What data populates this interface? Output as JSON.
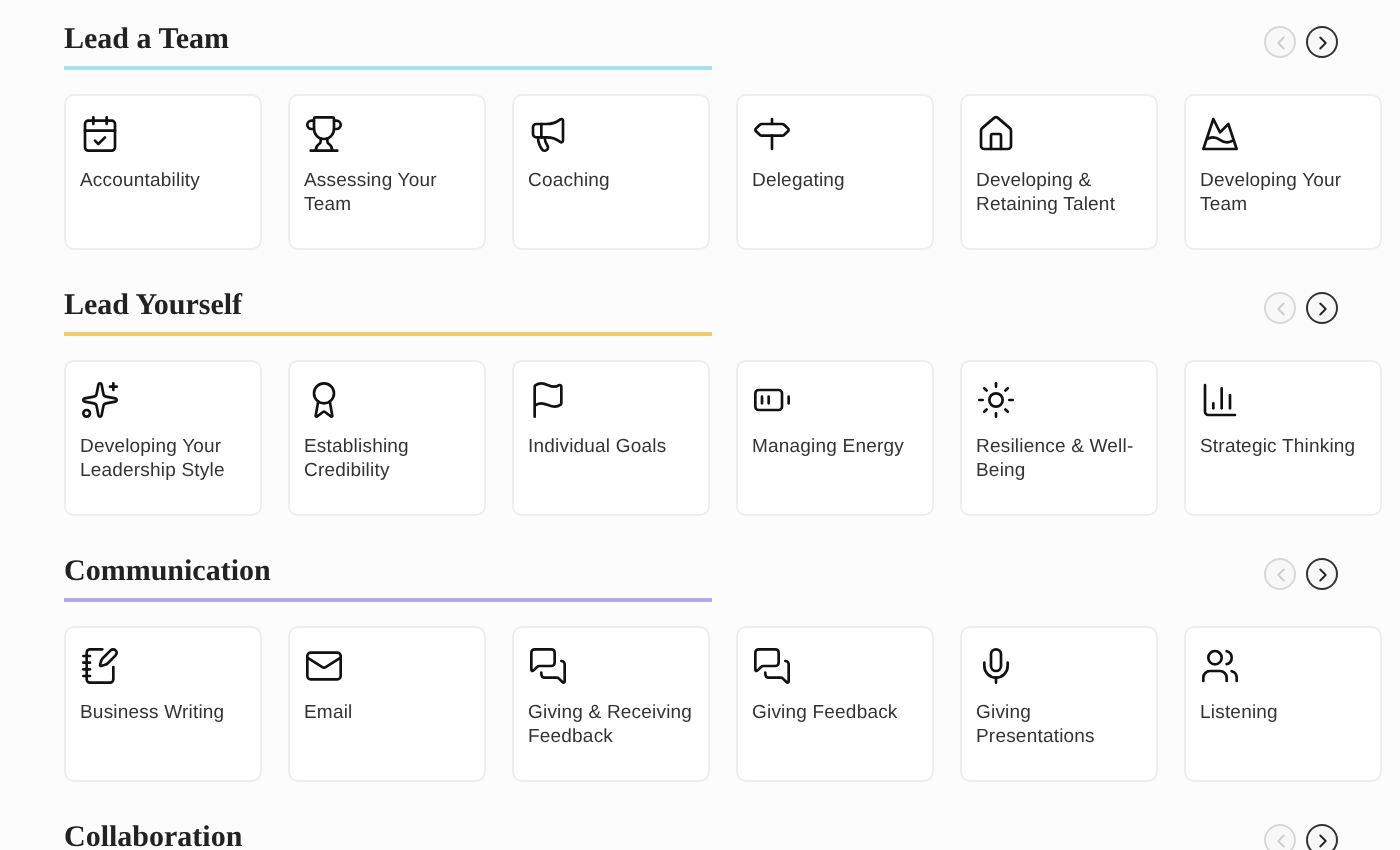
{
  "sections": [
    {
      "title": "Lead a Team",
      "color": "#a6e3ef",
      "nav": [
        {
          "kind": "prev",
          "disabled": true
        },
        {
          "kind": "next",
          "disabled": false
        }
      ],
      "cards": [
        "Accountability",
        "Assessing Your Team",
        "Coaching",
        "Delegating",
        "Developing & Retaining Talent",
        "Developing Your Team"
      ]
    },
    {
      "title": "Lead Yourself",
      "color": "#f3cc6a",
      "nav": [
        {
          "kind": "prev",
          "disabled": true
        },
        {
          "kind": "next",
          "disabled": false
        }
      ],
      "cards": [
        "Developing Your Leadership Style",
        "Establishing Credibility",
        "Individual Goals",
        "Managing Energy",
        "Resilience & Well-Being",
        "Strategic Thinking"
      ]
    },
    {
      "title": "Communication",
      "color": "#b3a6ea",
      "nav": [
        {
          "kind": "prev",
          "disabled": true
        },
        {
          "kind": "next",
          "disabled": false
        }
      ],
      "cards": [
        "Business Writing",
        "Email",
        "Giving & Receiving Feedback",
        "Giving Feedback",
        "Giving Presentations",
        "Listening"
      ]
    },
    {
      "title": "Collaboration",
      "nav": [
        {
          "kind": "prev",
          "disabled": true
        },
        {
          "kind": "next",
          "disabled": false
        }
      ]
    }
  ]
}
